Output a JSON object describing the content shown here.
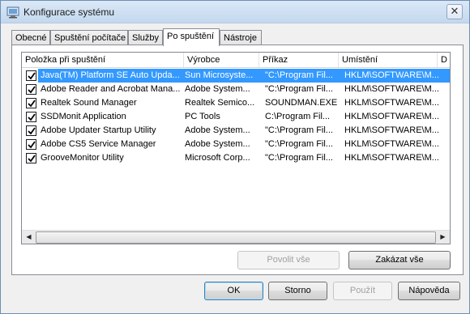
{
  "window": {
    "title": "Konfigurace systému",
    "close_glyph": "✕"
  },
  "tabs": [
    {
      "label": "Obecné",
      "active": false
    },
    {
      "label": "Spuštění počítače",
      "active": false
    },
    {
      "label": "Služby",
      "active": false
    },
    {
      "label": "Po spuštění",
      "active": true
    },
    {
      "label": "Nástroje",
      "active": false
    }
  ],
  "list": {
    "columns": [
      "Položka při spuštění",
      "Výrobce",
      "Příkaz",
      "Umístění",
      "D"
    ],
    "rows": [
      {
        "checked": true,
        "selected": true,
        "name": "Java(TM) Platform SE Auto Upda...",
        "vendor": "Sun Microsyste...",
        "command": "\"C:\\Program Fil...",
        "location": "HKLM\\SOFTWARE\\M..."
      },
      {
        "checked": true,
        "selected": false,
        "name": "Adobe Reader and Acrobat Mana...",
        "vendor": "Adobe System...",
        "command": "\"C:\\Program Fil...",
        "location": "HKLM\\SOFTWARE\\M..."
      },
      {
        "checked": true,
        "selected": false,
        "name": "Realtek Sound Manager",
        "vendor": "Realtek Semico...",
        "command": "SOUNDMAN.EXE",
        "location": "HKLM\\SOFTWARE\\M..."
      },
      {
        "checked": true,
        "selected": false,
        "name": "SSDMonit Application",
        "vendor": "PC Tools",
        "command": "C:\\Program Fil...",
        "location": "HKLM\\SOFTWARE\\M..."
      },
      {
        "checked": true,
        "selected": false,
        "name": "Adobe Updater Startup Utility",
        "vendor": "Adobe System...",
        "command": "\"C:\\Program Fil...",
        "location": "HKLM\\SOFTWARE\\M..."
      },
      {
        "checked": true,
        "selected": false,
        "name": "Adobe CS5 Service Manager",
        "vendor": "Adobe System...",
        "command": "\"C:\\Program Fil...",
        "location": "HKLM\\SOFTWARE\\M..."
      },
      {
        "checked": true,
        "selected": false,
        "name": "GrooveMonitor Utility",
        "vendor": "Microsoft Corp...",
        "command": "\"C:\\Program Fil...",
        "location": "HKLM\\SOFTWARE\\M..."
      }
    ],
    "scroll_left_glyph": "◀",
    "scroll_right_glyph": "▶"
  },
  "panel_buttons": {
    "enable_all": "Povolit vše",
    "disable_all": "Zakázat vše"
  },
  "dialog_buttons": {
    "ok": "OK",
    "cancel": "Storno",
    "apply": "Použít",
    "help": "Nápověda"
  },
  "colors": {
    "selection": "#3399ff",
    "titlebar": "#c3d8ee"
  },
  "icons": {
    "app": "system-config-icon",
    "close": "close-icon",
    "checkbox": "check-icon"
  }
}
